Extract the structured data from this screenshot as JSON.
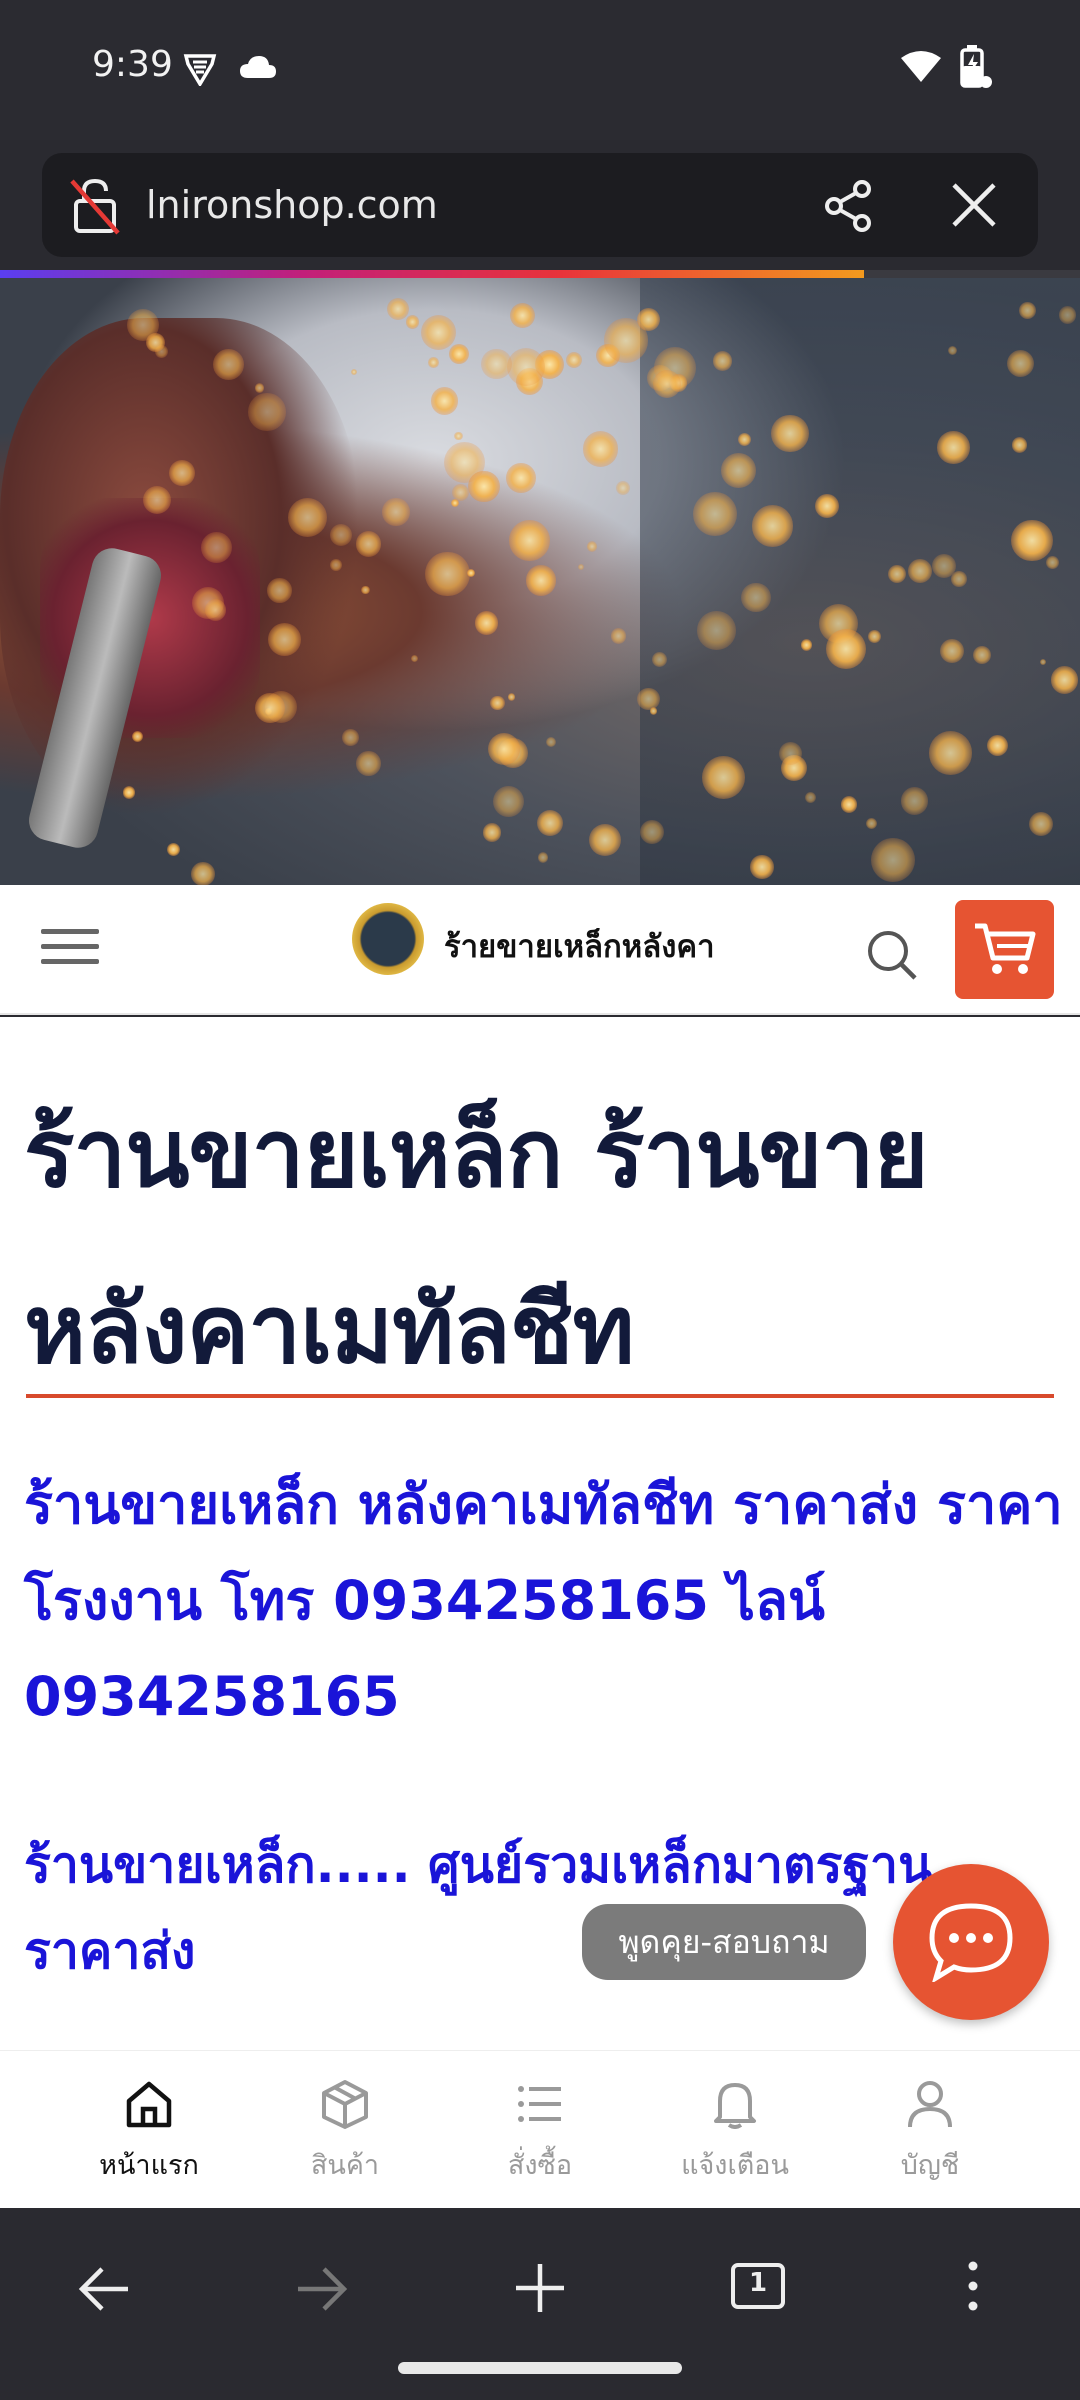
{
  "status_bar": {
    "time": "9:39"
  },
  "browser": {
    "url": "lnironshop.com",
    "load_progress": 0.8,
    "tab_count": "1"
  },
  "site_header": {
    "site_name": "ร้ายขายเหล็กหลังคา"
  },
  "article": {
    "title": "ร้านขายเหล็ก ร้านขายหลังคาเมทัลชีท",
    "subheading_1": "ร้านขายเหล็ก หลังคาเมทัลชีท ราคาส่ง ราคาโรงงาน โทร 0934258165 ไลน์ 0934258165",
    "subheading_2": "ร้านขายเหล็ก..... ศูนย์รวมเหล็กมาตรฐาน ราคาส่ง"
  },
  "chat": {
    "label": "พูดคุย-สอบถาม"
  },
  "app_nav": {
    "items": [
      {
        "label": "หน้าแรก",
        "icon": "home-icon",
        "active": true
      },
      {
        "label": "สินค้า",
        "icon": "box-icon",
        "active": false
      },
      {
        "label": "สั่งซื้อ",
        "icon": "list-icon",
        "active": false
      },
      {
        "label": "แจ้งเตือน",
        "icon": "bell-icon",
        "active": false
      },
      {
        "label": "บัญชี",
        "icon": "user-icon",
        "active": false
      }
    ]
  },
  "colors": {
    "accent": "#e65432",
    "heading": "#121a3a",
    "link_blue": "#1a14d8"
  }
}
